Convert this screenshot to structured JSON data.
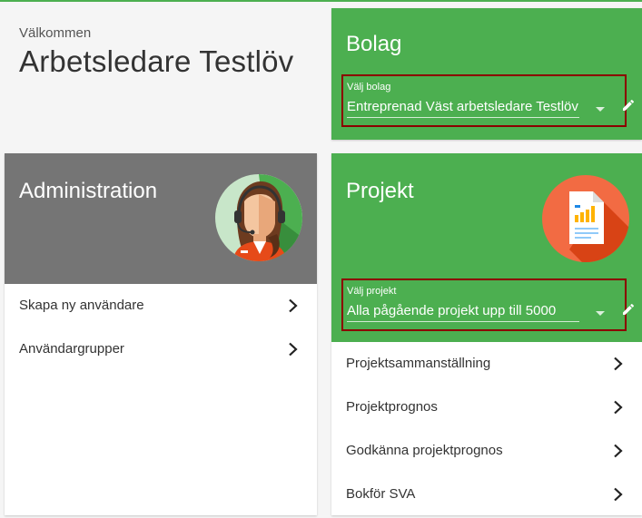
{
  "welcome": {
    "greeting": "Välkommen",
    "user_name": "Arbetsledare Testlöv"
  },
  "bolag": {
    "title": "Bolag",
    "select_label": "Välj bolag",
    "select_value": "Entreprenad Väst arbetsledare Testlöv"
  },
  "administration": {
    "title": "Administration",
    "avatar_icon": "support-agent-avatar-icon",
    "items": [
      {
        "label": "Skapa ny användare"
      },
      {
        "label": "Användargrupper"
      }
    ]
  },
  "projekt": {
    "title": "Projekt",
    "avatar_icon": "report-document-icon",
    "select_label": "Välj projekt",
    "select_value": "Alla pågående projekt upp till 5000",
    "items": [
      {
        "label": "Projektsammanställning"
      },
      {
        "label": "Projektprognos"
      },
      {
        "label": "Godkänna projektprognos"
      },
      {
        "label": "Bokför SVA"
      }
    ]
  },
  "colors": {
    "green": "#4caf50",
    "gray": "#757575",
    "highlight_border": "#8b0000"
  }
}
